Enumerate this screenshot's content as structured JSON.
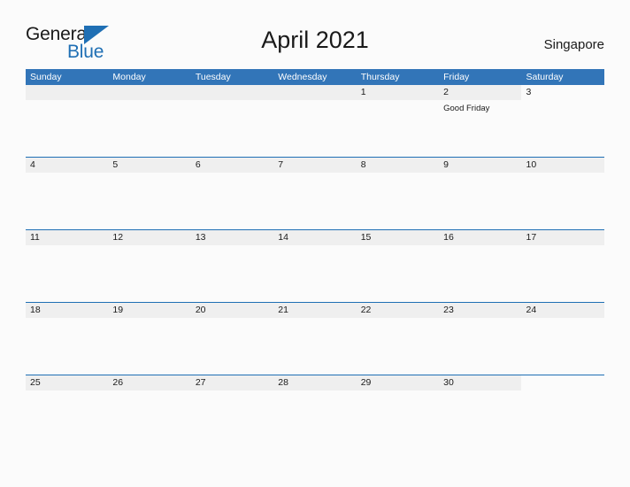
{
  "brand": {
    "name_part1": "General",
    "name_part2": "Blue",
    "color_primary": "#1f6fb4",
    "color_text": "#1a1a1a"
  },
  "header": {
    "title": "April 2021",
    "location": "Singapore"
  },
  "theme": {
    "header_blue": "#3275b8",
    "divider_blue": "#1f6fb4",
    "band_gray": "#efefef",
    "page_background": "#fbfbfb"
  },
  "calendar": {
    "month": "April",
    "year": "2021",
    "weekdays": [
      "Sunday",
      "Monday",
      "Tuesday",
      "Wednesday",
      "Thursday",
      "Friday",
      "Saturday"
    ],
    "weeks": [
      {
        "band_full": false,
        "days": [
          {
            "num": "",
            "events": []
          },
          {
            "num": "",
            "events": []
          },
          {
            "num": "",
            "events": []
          },
          {
            "num": "",
            "events": []
          },
          {
            "num": "1",
            "events": []
          },
          {
            "num": "2",
            "events": [
              "Good Friday"
            ]
          },
          {
            "num": "3",
            "events": []
          }
        ]
      },
      {
        "band_full": true,
        "days": [
          {
            "num": "4",
            "events": []
          },
          {
            "num": "5",
            "events": []
          },
          {
            "num": "6",
            "events": []
          },
          {
            "num": "7",
            "events": []
          },
          {
            "num": "8",
            "events": []
          },
          {
            "num": "9",
            "events": []
          },
          {
            "num": "10",
            "events": []
          }
        ]
      },
      {
        "band_full": true,
        "days": [
          {
            "num": "11",
            "events": []
          },
          {
            "num": "12",
            "events": []
          },
          {
            "num": "13",
            "events": []
          },
          {
            "num": "14",
            "events": []
          },
          {
            "num": "15",
            "events": []
          },
          {
            "num": "16",
            "events": []
          },
          {
            "num": "17",
            "events": []
          }
        ]
      },
      {
        "band_full": true,
        "days": [
          {
            "num": "18",
            "events": []
          },
          {
            "num": "19",
            "events": []
          },
          {
            "num": "20",
            "events": []
          },
          {
            "num": "21",
            "events": []
          },
          {
            "num": "22",
            "events": []
          },
          {
            "num": "23",
            "events": []
          },
          {
            "num": "24",
            "events": []
          }
        ]
      },
      {
        "band_full": false,
        "days": [
          {
            "num": "25",
            "events": []
          },
          {
            "num": "26",
            "events": []
          },
          {
            "num": "27",
            "events": []
          },
          {
            "num": "28",
            "events": []
          },
          {
            "num": "29",
            "events": []
          },
          {
            "num": "30",
            "events": []
          },
          {
            "num": "",
            "events": []
          }
        ]
      }
    ]
  }
}
